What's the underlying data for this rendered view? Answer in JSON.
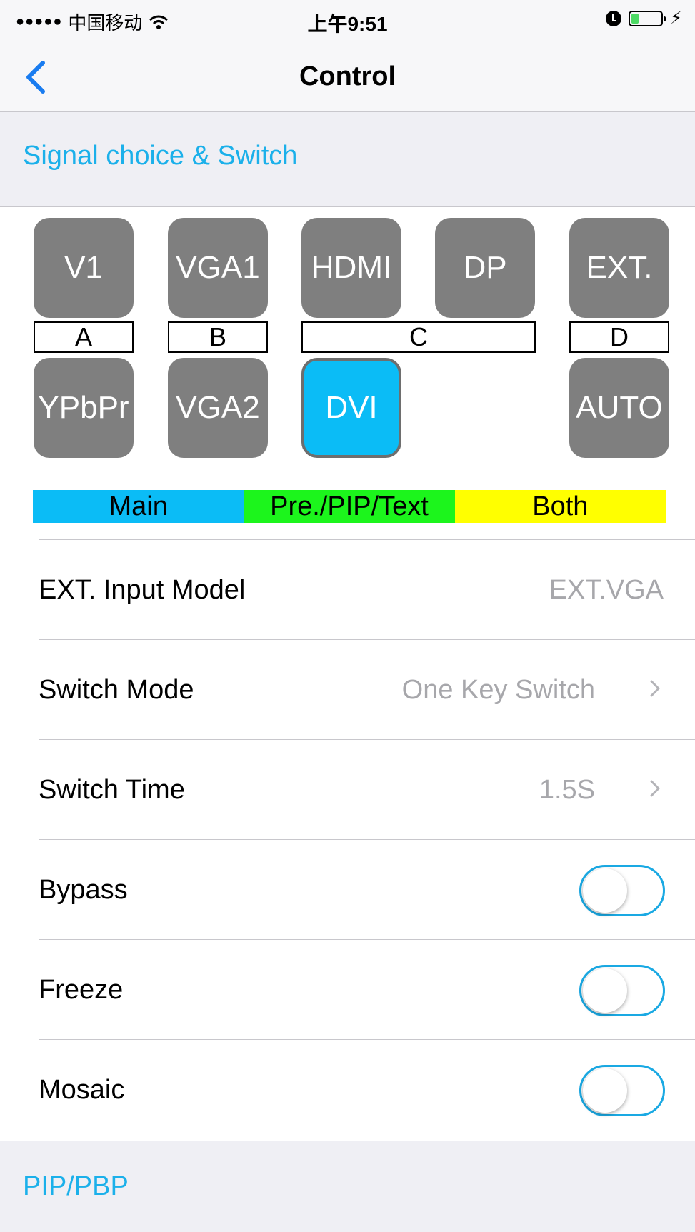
{
  "status_bar": {
    "signal_dots": "●●●●●",
    "carrier": "中国移动",
    "time": "上午9:51",
    "battery_level": 0.25,
    "icons": [
      "wifi-icon",
      "alarm-icon",
      "battery-icon",
      "charging-icon"
    ]
  },
  "nav": {
    "title": "Control",
    "back_icon": "chevron-left-icon"
  },
  "section_signal": {
    "title": "Signal choice & Switch"
  },
  "signals": {
    "row1": [
      "V1",
      "VGA1",
      "HDMI",
      "DP",
      "EXT."
    ],
    "groups": [
      "A",
      "B",
      "C",
      "D"
    ],
    "row2": [
      "YPbPr",
      "VGA2",
      "DVI",
      "AUTO"
    ],
    "selected": "DVI"
  },
  "legend": {
    "main": "Main",
    "pip": "Pre./PIP/Text",
    "both": "Both"
  },
  "colors": {
    "accent": "#1bb0ea",
    "button_gray": "#7f7f7f",
    "main": "#0bbcf6",
    "pip": "#1cf51c",
    "both": "#ffff00"
  },
  "settings": {
    "ext_input": {
      "label": "EXT. Input Model",
      "value": "EXT.VGA"
    },
    "switch_mode": {
      "label": "Switch Mode",
      "value": "One Key Switch"
    },
    "switch_time": {
      "label": "Switch Time",
      "value": "1.5S"
    },
    "bypass": {
      "label": "Bypass",
      "on": false
    },
    "freeze": {
      "label": "Freeze",
      "on": false
    },
    "mosaic": {
      "label": "Mosaic",
      "on": false
    }
  },
  "section_pip": {
    "title": "PIP/PBP"
  }
}
